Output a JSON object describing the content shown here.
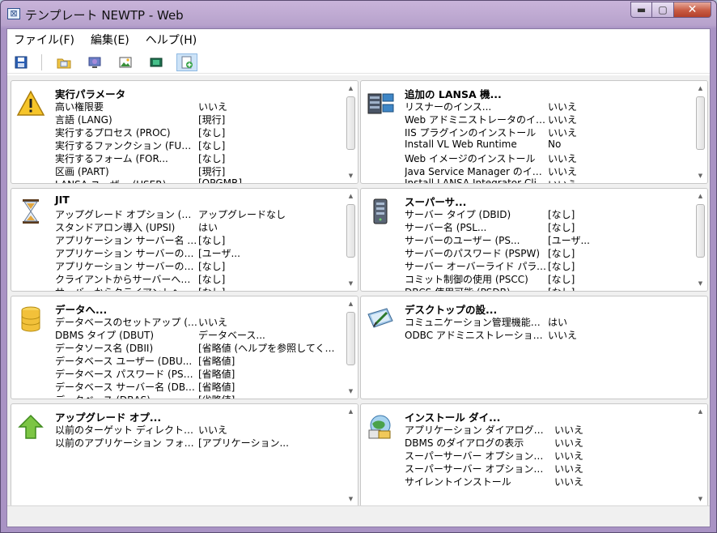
{
  "window": {
    "title": "テンプレート NEWTP - Web",
    "caption_minimize": "▬",
    "caption_maximize": "▢",
    "caption_close": "✕"
  },
  "menu": [
    "ファイル(F)",
    "編集(E)",
    "ヘルプ(H)"
  ],
  "toolbar": {
    "icons": [
      "save-icon",
      "folder-icon",
      "monitor-icon",
      "image-icon",
      "film-icon",
      "new-doc-icon"
    ]
  },
  "panels": [
    {
      "title": "実行パラメータ",
      "icon": "warning-icon",
      "rows": [
        {
          "label": "高い権限要",
          "value": "いいえ"
        },
        {
          "label": "言語 (LANG)",
          "value": "[現行]"
        },
        {
          "label": "実行するプロセス (PROC)",
          "value": "[なし]"
        },
        {
          "label": "実行するファンクション (FUNC)",
          "value": "[なし]"
        },
        {
          "label": "実行するフォーム (FOR...",
          "value": "[なし]"
        },
        {
          "label": "区画 (PART)",
          "value": "[現行]"
        },
        {
          "label": "LANSA ユーザー (USER)",
          "value": "[QPGMR]"
        }
      ]
    },
    {
      "title": "追加の LANSA 機...",
      "icon": "servers-icon",
      "rows": [
        {
          "label": "リスナーのインス...",
          "value": "いいえ"
        },
        {
          "label": "Web アドミニストレータのインスト...",
          "value": "いいえ"
        },
        {
          "label": "IIS プラグインのインストール",
          "value": "いいえ"
        },
        {
          "label": "Install VL Web Runtime",
          "value": "No"
        },
        {
          "label": "Web イメージのインストール",
          "value": "いいえ"
        },
        {
          "label": "Java Service Manager のインス...",
          "value": "いいえ"
        },
        {
          "label": "Install LANSA Integrator Cli...",
          "value": "いいえ"
        }
      ]
    },
    {
      "title": "JIT",
      "icon": "hourglass-icon",
      "rows": [
        {
          "label": "アップグレード オプション (UPGD)",
          "value": "アップグレードなし"
        },
        {
          "label": "スタンドアロン導入 (UPSI)",
          "value": "はい"
        },
        {
          "label": "アプリケーション サーバー名 (AS...",
          "value": "[なし]"
        },
        {
          "label": "アプリケーション サーバーのユーザー (A...",
          "value": "[ユーザ..."
        },
        {
          "label": "アプリケーション サーバーのパスワード (...",
          "value": "[なし]"
        },
        {
          "label": "クライアントからサーバーへの変換テ...",
          "value": "[なし]"
        },
        {
          "label": "サーバーからクライアントへの変換テ...",
          "value": "[なし]"
        }
      ]
    },
    {
      "title": "スーパーサ...",
      "icon": "server-tower-icon",
      "rows": [
        {
          "label": "サーバー タイプ (DBID)",
          "value": "[なし]"
        },
        {
          "label": "サーバー名 (PSL...",
          "value": "[なし]"
        },
        {
          "label": "サーバーのユーザー (PS...",
          "value": "[ユーザ..."
        },
        {
          "label": "サーバーのパスワード (PSPW)",
          "value": "[なし]"
        },
        {
          "label": "サーバー オーバーライド パラメーター (P...",
          "value": "[なし]"
        },
        {
          "label": "コミット制御の使用 (PSCC)",
          "value": "[なし]"
        },
        {
          "label": "DBCS 使用可能 (PSDB)",
          "value": "[なし]"
        }
      ]
    },
    {
      "title": "データへ...",
      "icon": "database-icon",
      "rows": [
        {
          "label": "データベースのセットアップ (SUDB)",
          "value": "いいえ"
        },
        {
          "label": "DBMS タイプ (DBUT)",
          "value": "データベース..."
        },
        {
          "label": "データソース名 (DBII)",
          "value": "[省略値 (ヘルプを参照してくださ..."
        },
        {
          "label": "データベース ユーザー (DBU...",
          "value": "[省略値]"
        },
        {
          "label": "データベース パスワード (PSWD)",
          "value": "[省略値]"
        },
        {
          "label": "データベース サーバー名 (DBS...",
          "value": "[省略値]"
        },
        {
          "label": "データベース (DBAS)",
          "value": "[省略値]"
        }
      ]
    },
    {
      "title": "デスクトップの設...",
      "icon": "desktop-shortcut-icon",
      "rows": [
        {
          "label": "コミュニケーション管理機能のショートカット...",
          "value": "はい"
        },
        {
          "label": "ODBC アドミニストレーションのショートカット...",
          "value": "いいえ"
        }
      ]
    },
    {
      "title": "アップグレード オプ...",
      "icon": "upgrade-arrow-icon",
      "rows": [
        {
          "label": "以前のターゲット ディレクトリの削除 (D...",
          "value": "いいえ"
        },
        {
          "label": "以前のアプリケーション フォルダー名 (U...",
          "value": "[アプリケーション..."
        }
      ]
    },
    {
      "title": "インストール ダイ...",
      "icon": "install-dialog-icon",
      "rows": [
        {
          "label": "アプリケーション ダイアログの表示",
          "value": "いいえ"
        },
        {
          "label": "DBMS のダイアログの表示",
          "value": "いいえ"
        },
        {
          "label": "スーパーサーバー オプションの表示...",
          "value": "いいえ"
        },
        {
          "label": "スーパーサーバー オプションの表示...",
          "value": "いいえ"
        },
        {
          "label": "サイレントインストール",
          "value": "いいえ"
        }
      ]
    }
  ],
  "scroll_arrows": {
    "up": "▲",
    "down": "▼"
  }
}
